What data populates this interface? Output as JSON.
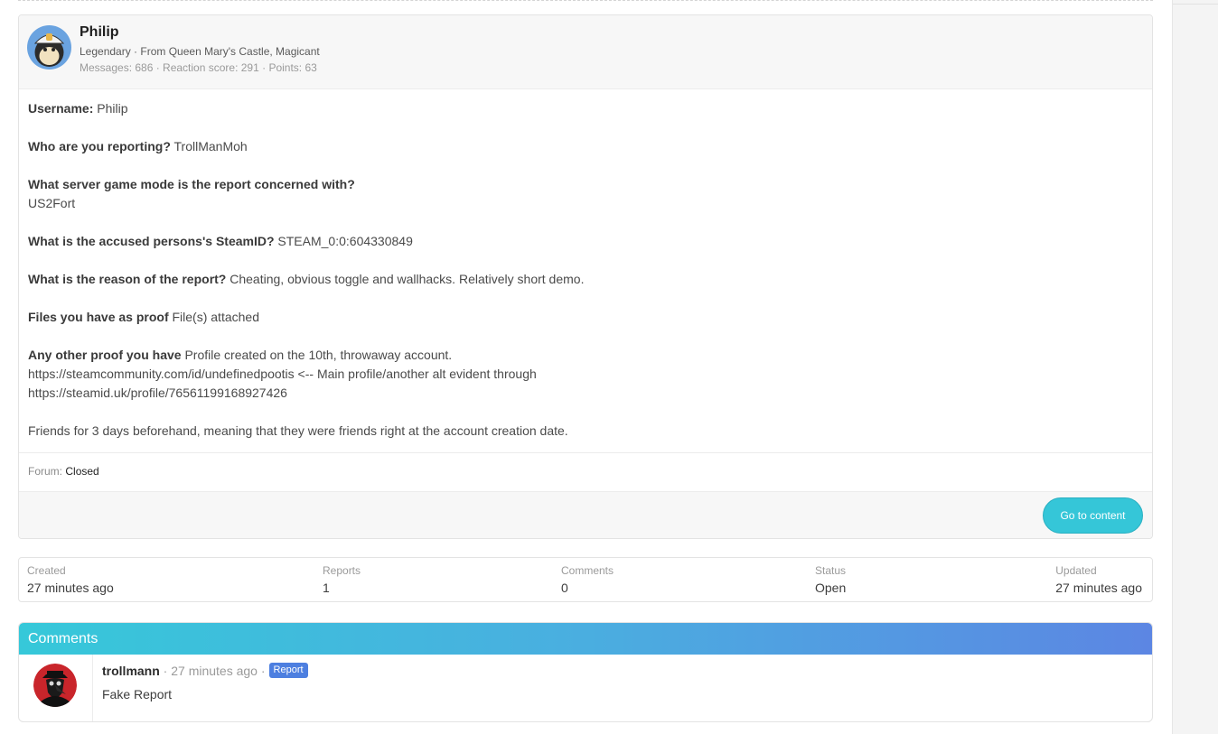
{
  "report": {
    "user": {
      "name": "Philip",
      "info_line": "Legendary · From Queen Mary's Castle, Magicant",
      "stats_line": "Messages: 686 · Reaction score: 291 · Points: 63"
    },
    "fields": [
      {
        "label": "Username:",
        "value": " Philip"
      },
      {
        "label": "Who are you reporting?",
        "value": " TrollManMoh"
      },
      {
        "label": "What server game mode is the report concerned with?",
        "value": "US2Fort"
      },
      {
        "label": "What is the accused persons's SteamID?",
        "value": " STEAM_0:0:604330849"
      },
      {
        "label": "What is the reason of the report?",
        "value": " Cheating, obvious toggle and wallhacks. Relatively short demo."
      },
      {
        "label": "Files you have as proof",
        "value": " File(s) attached"
      },
      {
        "label": "Any other proof you have",
        "value": " Profile created on the 10th, throwaway account."
      }
    ],
    "extra_lines": [
      "https://steamcommunity.com/id/undefinedpootis <-- Main profile/another alt evident through",
      "https://steamid.uk/profile/76561199168927426"
    ],
    "closing_note": "Friends for 3 days beforehand, meaning that they were friends right at the account creation date.",
    "forum_label": "Forum:",
    "forum_value": "Closed",
    "go_button_label": "Go to content"
  },
  "stats": {
    "created": {
      "label": "Created",
      "value": "27 minutes ago"
    },
    "reports": {
      "label": "Reports",
      "value": "1"
    },
    "comments": {
      "label": "Comments",
      "value": "0"
    },
    "status": {
      "label": "Status",
      "value": "Open"
    },
    "updated": {
      "label": "Updated",
      "value": "27 minutes ago"
    }
  },
  "comments_section": {
    "title": "Comments",
    "items": [
      {
        "author": "trollmann",
        "time": "27 minutes ago",
        "badge": "Report",
        "text": "Fake Report"
      }
    ]
  },
  "colors": {
    "accent": "#35c6d8",
    "gradient_start": "#36c8d9",
    "gradient_end": "#5c86e3",
    "badge": "#4d7fe0"
  }
}
